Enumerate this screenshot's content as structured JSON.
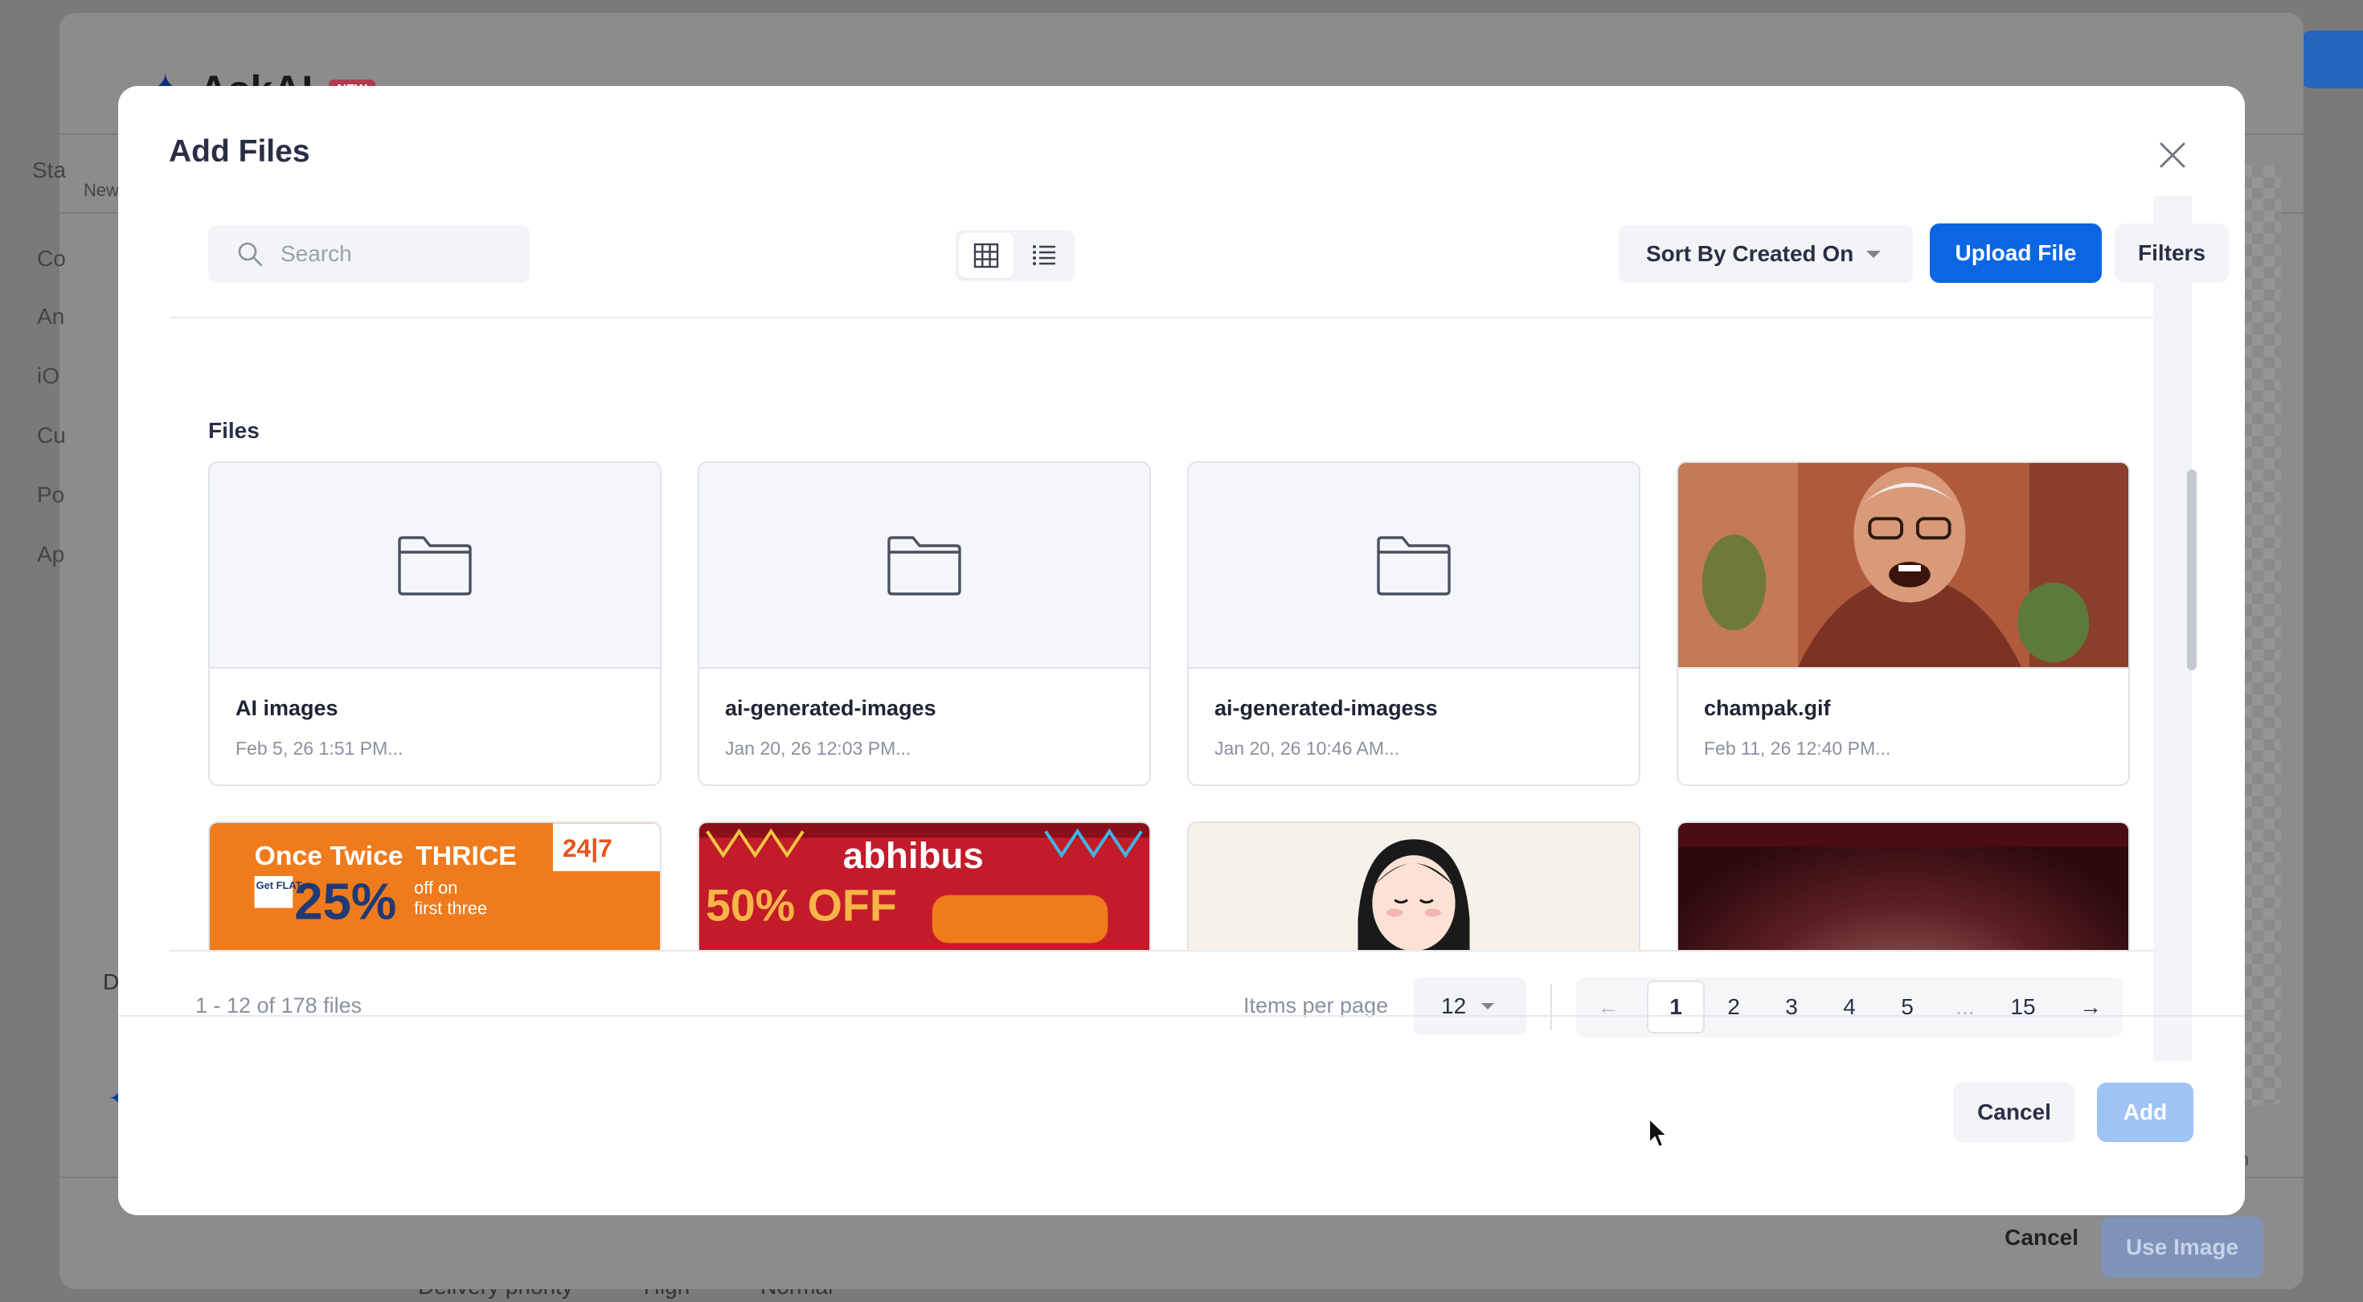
{
  "background": {
    "app_title": "AskAI",
    "badge": "NEW",
    "sidebar_items": [
      "Sta",
      "New",
      "Co",
      "An",
      "iO",
      "Cu",
      "Po",
      "Ap",
      "D"
    ],
    "cancel_label": "Cancel",
    "use_image_label": "Use Image",
    "bottom_fields": [
      "Delivery priority",
      "High",
      "Normal"
    ],
    "side_note": "th"
  },
  "dialog": {
    "title": "Add Files",
    "search": {
      "placeholder": "Search",
      "value": ""
    },
    "view_mode": "grid",
    "sort_label": "Sort By Created On",
    "upload_label": "Upload File",
    "filters_label": "Filters",
    "section_label": "Files",
    "files": [
      {
        "name": "AI images",
        "date": "Feb 5, 26 1:51 PM...",
        "kind": "folder"
      },
      {
        "name": "ai-generated-images",
        "date": "Jan 20, 26 12:03 PM...",
        "kind": "folder"
      },
      {
        "name": "ai-generated-imagess",
        "date": "Jan 20, 26 10:46 AM...",
        "kind": "folder"
      },
      {
        "name": "champak.gif",
        "date": "Feb 11, 26 12:40 PM...",
        "kind": "image"
      }
    ],
    "previews": {
      "promo1": {
        "line1": "Once Twice",
        "line2": "THRICE",
        "badge": "24|7",
        "get_flat": "Get FLAT",
        "percent": "25%",
        "offer": "off on",
        "offer2": "first three"
      },
      "promo2": {
        "brand": "abhibus",
        "offer": "50% OFF"
      }
    },
    "pagination": {
      "summary": "1 - 12 of 178 files",
      "items_per_page_label": "Items per page",
      "items_per_page": "12",
      "prev": "←",
      "next": "→",
      "pages": [
        "1",
        "2",
        "3",
        "4",
        "5",
        "...",
        "15"
      ],
      "current_page": "1"
    },
    "footer": {
      "cancel_label": "Cancel",
      "add_label": "Add"
    }
  }
}
